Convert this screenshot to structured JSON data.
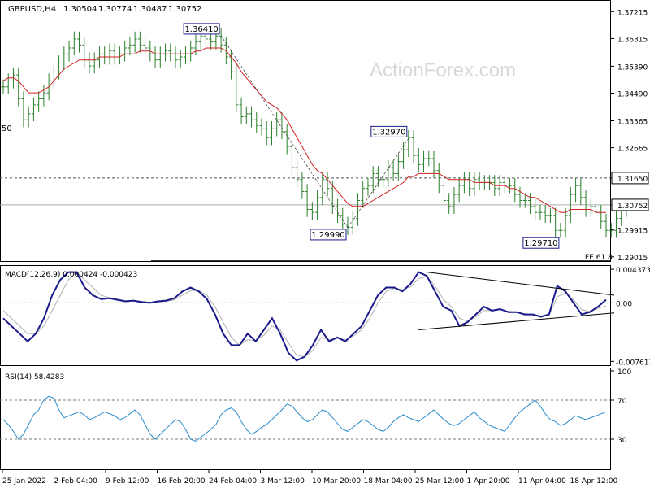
{
  "header": {
    "symbol": "GBPUSD,H4",
    "open": "1.30504",
    "high": "1.30774",
    "low": "1.30487",
    "close": "1.30752"
  },
  "watermark": "ActionForex.com",
  "colors": {
    "price_bars": "#2a7f2a",
    "moving_average": "#d02020",
    "macd_line": "#1a1a8c",
    "macd_signal": "#b0b0b0",
    "rsi_line": "#2a8ccc",
    "grid_dashed": "#7a7a7a"
  },
  "chart_data": [
    {
      "type": "line",
      "panel": "price",
      "y_ticks": [
        "1.37215",
        "1.36315",
        "1.35390",
        "1.34490",
        "1.33565",
        "1.32665",
        "1.31650",
        "1.30752",
        "1.29915",
        "1.29015"
      ],
      "ylim": [
        1.289,
        1.3755
      ],
      "grid": false,
      "x_count": 120,
      "series": [
        {
          "values": [
            1.347,
            1.349,
            1.351,
            1.343,
            1.336,
            1.338,
            1.341,
            1.343,
            1.345,
            1.349,
            1.352,
            1.355,
            1.358,
            1.36,
            1.363,
            1.361,
            1.356,
            1.354,
            1.356,
            1.358,
            1.357,
            1.359,
            1.357,
            1.358,
            1.36,
            1.361,
            1.363,
            1.361,
            1.36,
            1.358,
            1.356,
            1.358,
            1.359,
            1.358,
            1.356,
            1.357,
            1.358,
            1.36,
            1.362,
            1.364,
            1.363,
            1.362,
            1.364,
            1.361,
            1.357,
            1.352,
            1.341,
            1.337,
            1.338,
            1.336,
            1.334,
            1.333,
            1.33,
            1.333,
            1.336,
            1.332,
            1.327,
            1.32,
            1.316,
            1.312,
            1.306,
            1.305,
            1.31,
            1.316,
            1.313,
            1.307,
            1.304,
            1.301,
            1.3,
            1.303,
            1.309,
            1.313,
            1.314,
            1.318,
            1.316,
            1.316,
            1.32,
            1.318,
            1.322,
            1.326,
            1.33,
            1.324,
            1.321,
            1.323,
            1.323,
            1.319,
            1.314,
            1.309,
            1.307,
            1.311,
            1.314,
            1.316,
            1.313,
            1.316,
            1.315,
            1.315,
            1.315,
            1.313,
            1.315,
            1.314,
            1.314,
            1.311,
            1.309,
            1.309,
            1.307,
            1.305,
            1.305,
            1.304,
            1.304,
            1.299,
            1.299,
            1.304,
            1.311,
            1.314,
            1.31,
            1.306,
            1.307,
            1.305,
            1.302,
            1.299,
            1.299,
            1.303,
            1.306,
            1.307
          ]
        },
        {
          "values": [
            1.349,
            1.35,
            1.35,
            1.349,
            1.347,
            1.345,
            1.345,
            1.345,
            1.346,
            1.347,
            1.349,
            1.351,
            1.353,
            1.354,
            1.355,
            1.356,
            1.356,
            1.356,
            1.356,
            1.357,
            1.357,
            1.357,
            1.357,
            1.357,
            1.358,
            1.358,
            1.358,
            1.359,
            1.359,
            1.359,
            1.358,
            1.358,
            1.358,
            1.358,
            1.358,
            1.358,
            1.358,
            1.358,
            1.359,
            1.359,
            1.36,
            1.36,
            1.36,
            1.36,
            1.359,
            1.357,
            1.355,
            1.352,
            1.35,
            1.348,
            1.346,
            1.344,
            1.342,
            1.341,
            1.34,
            1.338,
            1.336,
            1.333,
            1.33,
            1.327,
            1.324,
            1.321,
            1.319,
            1.318,
            1.316,
            1.314,
            1.312,
            1.31,
            1.308,
            1.307,
            1.307,
            1.307,
            1.308,
            1.309,
            1.31,
            1.311,
            1.312,
            1.313,
            1.314,
            1.315,
            1.317,
            1.317,
            1.318,
            1.318,
            1.318,
            1.318,
            1.318,
            1.317,
            1.316,
            1.316,
            1.316,
            1.316,
            1.316,
            1.315,
            1.315,
            1.315,
            1.315,
            1.314,
            1.314,
            1.314,
            1.313,
            1.313,
            1.312,
            1.311,
            1.31,
            1.31,
            1.309,
            1.308,
            1.307,
            1.306,
            1.305,
            1.305,
            1.306,
            1.306,
            1.306,
            1.306,
            1.306,
            1.305,
            1.305,
            1.305
          ]
        }
      ],
      "annotations": [
        {
          "text": "1.36410",
          "x": 43,
          "y": 1.3641
        },
        {
          "text": "1.32970",
          "x": 80,
          "y": 1.3297
        },
        {
          "text": "1.29990",
          "x": 68,
          "y": 1.2999
        },
        {
          "text": "1.29710",
          "x": 110,
          "y": 1.2971
        }
      ],
      "horizontal_levels": [
        {
          "value": 1.3165,
          "label": "1.31650",
          "style": "dashed"
        },
        {
          "value": 1.30752,
          "label": "1.30752",
          "style": "solid"
        }
      ],
      "fe_label": "FE 61.8",
      "left_edge_label": "50"
    },
    {
      "type": "line",
      "panel": "macd",
      "title": "MACD(12,26,9) 0.000424 -0.000423",
      "y_ticks": [
        "0.004373",
        "0.00",
        "-0.007613"
      ],
      "ylim": [
        -0.008,
        0.0047
      ],
      "series": [
        {
          "values": [
            -0.002,
            -0.003,
            -0.004,
            -0.005,
            -0.004,
            -0.002,
            0.001,
            0.003,
            0.004,
            0.004,
            0.002,
            0.001,
            0.0005,
            0.0006,
            0.0004,
            0.0002,
            0.0003,
            0.0001,
            0.0,
            0.0002,
            0.0003,
            0.0006,
            0.0015,
            0.002,
            0.0015,
            0.0005,
            -0.0015,
            -0.004,
            -0.0055,
            -0.0055,
            -0.004,
            -0.005,
            -0.0035,
            -0.002,
            -0.004,
            -0.0065,
            -0.0075,
            -0.007,
            -0.0055,
            -0.0035,
            -0.005,
            -0.0045,
            -0.005,
            -0.004,
            -0.003,
            -0.001,
            0.001,
            0.002,
            0.002,
            0.0015,
            0.0025,
            0.004,
            0.0035,
            0.0015,
            -0.0005,
            -0.001,
            -0.003,
            -0.0025,
            -0.0015,
            -0.0005,
            -0.001,
            -0.0008,
            -0.0012,
            -0.0012,
            -0.0015,
            -0.0015,
            -0.0018,
            -0.0015,
            0.0022,
            0.0015,
            0.0,
            -0.0015,
            -0.0012,
            -0.0005,
            0.0004
          ]
        },
        {
          "values": [
            -0.001,
            -0.002,
            -0.003,
            -0.004,
            -0.004,
            -0.003,
            -0.001,
            0.001,
            0.003,
            0.004,
            0.003,
            0.002,
            0.001,
            0.0007,
            0.0005,
            0.0003,
            0.0003,
            0.0002,
            0.0001,
            0.0001,
            0.0002,
            0.0004,
            0.001,
            0.0016,
            0.0016,
            0.001,
            -0.0005,
            -0.0025,
            -0.0045,
            -0.0055,
            -0.0048,
            -0.0049,
            -0.0042,
            -0.003,
            -0.0035,
            -0.0052,
            -0.0068,
            -0.007,
            -0.0062,
            -0.0045,
            -0.0048,
            -0.0046,
            -0.0048,
            -0.0043,
            -0.0035,
            -0.002,
            0.0,
            0.0015,
            0.0019,
            0.0017,
            0.0021,
            0.0032,
            0.0034,
            0.0022,
            0.0005,
            -0.0005,
            -0.002,
            -0.0024,
            -0.0018,
            -0.001,
            -0.001,
            -0.0009,
            -0.0011,
            -0.0012,
            -0.0014,
            -0.0015,
            -0.0017,
            -0.0016,
            0.0008,
            0.0013,
            0.0004,
            -0.0009,
            -0.0011,
            -0.0007,
            -0.0004
          ]
        }
      ],
      "trendlines": [
        {
          "from": [
            52,
            0.004
          ],
          "to": [
            75,
            0.001
          ]
        },
        {
          "from": [
            51,
            -0.0035
          ],
          "to": [
            75,
            -0.0013
          ]
        }
      ]
    },
    {
      "type": "line",
      "panel": "rsi",
      "title": "RSI(14) 58.4283",
      "y_ticks": [
        "100",
        "70",
        "30"
      ],
      "ylim": [
        0,
        100
      ],
      "levels": [
        70,
        30
      ],
      "series": [
        {
          "values": [
            50,
            45,
            38,
            30,
            35,
            45,
            55,
            60,
            70,
            74,
            72,
            60,
            52,
            54,
            56,
            58,
            55,
            50,
            52,
            55,
            58,
            56,
            54,
            50,
            52,
            56,
            60,
            55,
            45,
            35,
            30,
            35,
            40,
            45,
            50,
            48,
            40,
            30,
            28,
            32,
            36,
            40,
            45,
            55,
            60,
            62,
            58,
            48,
            40,
            35,
            38,
            42,
            45,
            50,
            55,
            60,
            66,
            64,
            58,
            52,
            48,
            50,
            55,
            60,
            58,
            52,
            46,
            40,
            38,
            42,
            46,
            50,
            48,
            44,
            40,
            38,
            42,
            48,
            52,
            55,
            52,
            50,
            48,
            52,
            56,
            60,
            55,
            50,
            46,
            44,
            46,
            50,
            54,
            58,
            52,
            48,
            44,
            42,
            40,
            38,
            45,
            52,
            58,
            62,
            66,
            70,
            64,
            56,
            50,
            48,
            44,
            46,
            50,
            54,
            52,
            50,
            52,
            54,
            56,
            58
          ]
        }
      ]
    }
  ],
  "x_axis_labels": [
    "25 Jan 2022",
    "2 Feb 04:00",
    "9 Feb 12:00",
    "16 Feb 20:00",
    "24 Feb 04:00",
    "3 Mar 12:00",
    "10 Mar 20:00",
    "18 Mar 04:00",
    "25 Mar 12:00",
    "1 Apr 20:00",
    "11 Apr 04:00",
    "18 Apr 12:00"
  ]
}
